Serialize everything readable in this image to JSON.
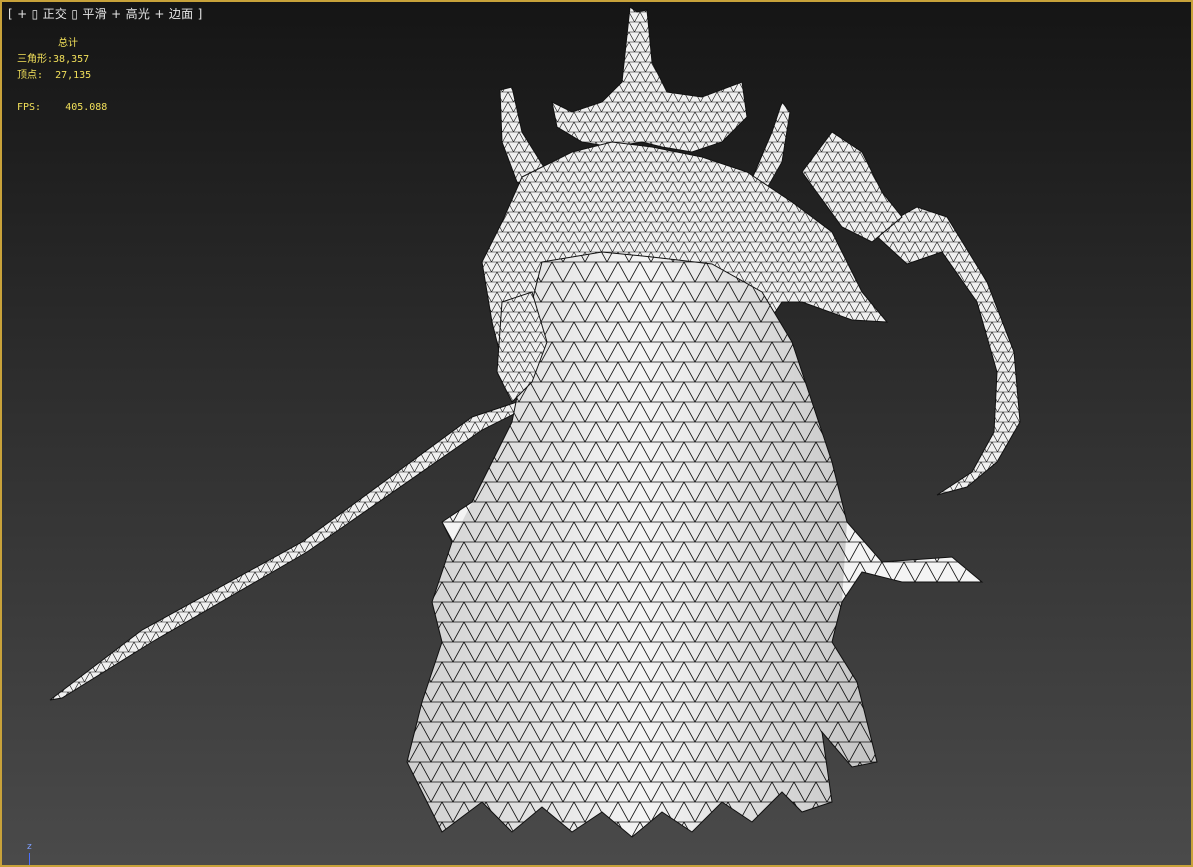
{
  "viewport": {
    "label_parts": {
      "open": "[",
      "plus": "+",
      "box1": "▯",
      "view": "正交",
      "box2": "▯",
      "shading": "平滑",
      "plus2": "+",
      "highlight": "高光",
      "plus3": "+",
      "edges": "边面",
      "close": "]"
    },
    "border_color": "#c8a23a"
  },
  "stats": {
    "title": "总计",
    "triangles_label": "三角形:",
    "triangles_value": "38,357",
    "vertices_label": "顶点:",
    "vertices_value": "27,135",
    "fps_label": "FPS:",
    "fps_value": "405.088",
    "text_color": "#f2e05a"
  },
  "axis_gizmo": {
    "z_label": "z"
  },
  "model": {
    "description_icon": "reaper-wireframe-model",
    "fill_color": "#f4f4f4",
    "edge_color": "#111111"
  }
}
